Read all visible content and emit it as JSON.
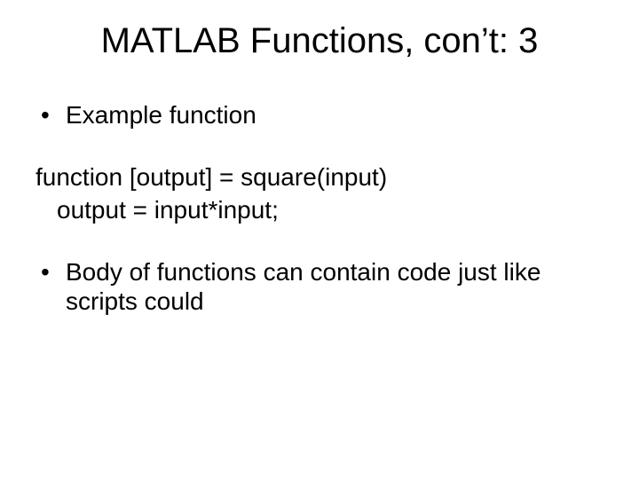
{
  "title": "MATLAB Functions, con’t: 3",
  "bullets": {
    "first": "Example function",
    "last": "Body of functions can contain code just like scripts could"
  },
  "code": {
    "line1": "function [output] = square(input)",
    "line2": "output = input*input;"
  }
}
